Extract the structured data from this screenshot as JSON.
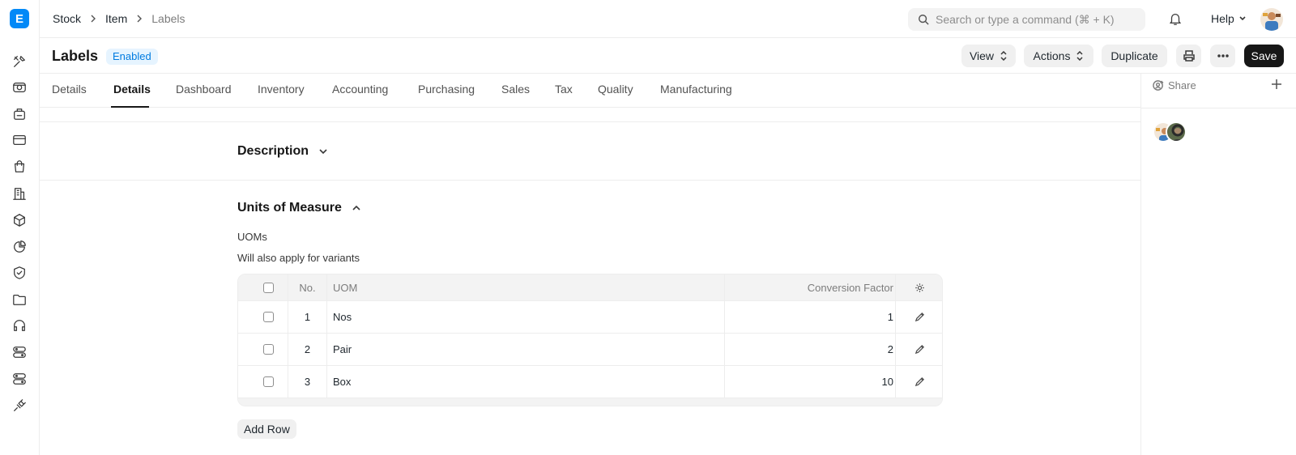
{
  "app": {
    "logo_letter": "E",
    "brand_color": "#0289f7"
  },
  "sidebar": {
    "icons": [
      "tools-icon",
      "camera-icon",
      "printer-box-icon",
      "card-icon",
      "shopping-bag-icon",
      "building-icon",
      "package-icon",
      "pie-chart-icon",
      "shield-check-icon",
      "folder-icon",
      "headset-icon",
      "server-icon",
      "server-icon",
      "plug-icon"
    ]
  },
  "navbar": {
    "breadcrumbs": [
      "Stock",
      "Item",
      "Labels"
    ],
    "search_placeholder": "Search or type a command (⌘ + K)",
    "help_label": "Help"
  },
  "page": {
    "title": "Labels",
    "status": "Enabled",
    "buttons": {
      "view": "View",
      "actions": "Actions",
      "duplicate": "Duplicate",
      "save": "Save"
    }
  },
  "tabs": [
    "Details",
    "Details",
    "Dashboard",
    "Inventory",
    "Accounting",
    "Purchasing",
    "Sales",
    "Tax",
    "Quality",
    "Manufacturing"
  ],
  "active_tab_index": 1,
  "right_sidebar": {
    "share_label": "Share"
  },
  "sections": {
    "description": {
      "title": "Description"
    },
    "uom": {
      "title": "Units of Measure",
      "field_label": "UOMs",
      "description": "Will also apply for variants",
      "table": {
        "headers": {
          "no": "No.",
          "uom": "UOM",
          "factor": "Conversion Factor"
        },
        "rows": [
          {
            "no": "1",
            "uom": "Nos",
            "factor": "1"
          },
          {
            "no": "2",
            "uom": "Pair",
            "factor": "2"
          },
          {
            "no": "3",
            "uom": "Box",
            "factor": "10"
          }
        ]
      },
      "add_row_label": "Add Row"
    }
  }
}
